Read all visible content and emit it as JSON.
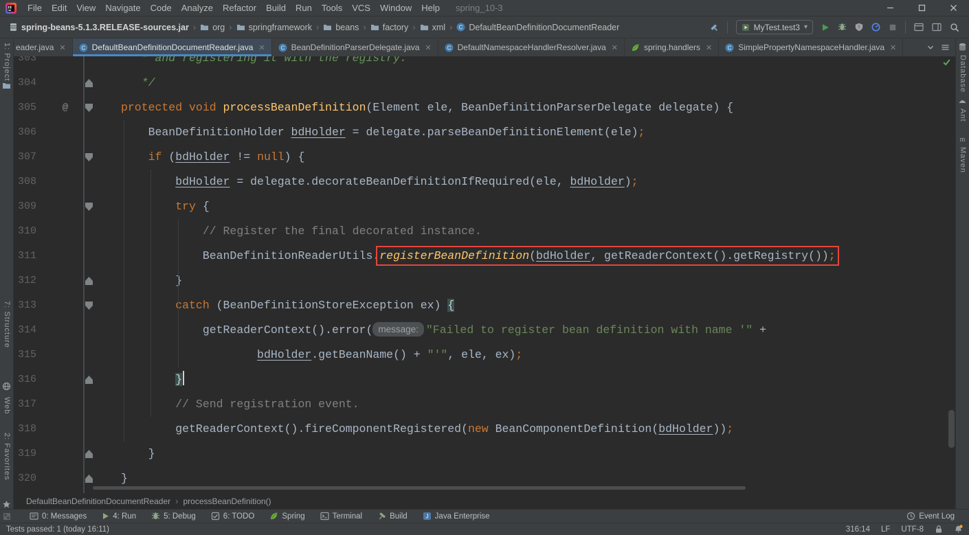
{
  "ui": {
    "chevron": "›",
    "close": "✕",
    "at": "@",
    "dropdown": "▾"
  },
  "colors": {
    "chrome_bg": "#3c3f41",
    "editor_bg": "#2b2b2b",
    "accent_blue": "#4A88C7",
    "error_red": "#e8443c",
    "run_green": "#499C54",
    "keyword_orange": "#cc7832",
    "method_yellow": "#ffc66b",
    "string_green": "#6a8759",
    "comment_gray": "#808080",
    "doc_green": "#629755",
    "brace_match_bg": "#3b514d"
  },
  "menu": {
    "items": [
      "File",
      "Edit",
      "View",
      "Navigate",
      "Code",
      "Analyze",
      "Refactor",
      "Build",
      "Run",
      "Tools",
      "VCS",
      "Window",
      "Help"
    ],
    "project": "spring_10-3"
  },
  "navbar": {
    "path": [
      {
        "label": "spring-beans-5.1.3.RELEASE-sources.jar",
        "icon": "jar",
        "bold": true
      },
      {
        "label": "org",
        "icon": "folder"
      },
      {
        "label": "springframework",
        "icon": "folder"
      },
      {
        "label": "beans",
        "icon": "folder"
      },
      {
        "label": "factory",
        "icon": "folder"
      },
      {
        "label": "xml",
        "icon": "folder"
      },
      {
        "label": "DefaultBeanDefinitionDocumentReader",
        "icon": "class"
      }
    ],
    "run_config": "MyTest.test3"
  },
  "tabs": [
    {
      "label": "eader.java",
      "icon": null,
      "partial": true
    },
    {
      "label": "DefaultBeanDefinitionDocumentReader.java",
      "icon": "class",
      "active": true
    },
    {
      "label": "BeanDefinitionParserDelegate.java",
      "icon": "class"
    },
    {
      "label": "DefaultNamespaceHandlerResolver.java",
      "icon": "class"
    },
    {
      "label": "spring.handlers",
      "icon": "spring-leaf"
    },
    {
      "label": "SimplePropertyNamespaceHandler.java",
      "icon": "class"
    }
  ],
  "editor": {
    "lines": [
      {
        "num": 303,
        "groups": [
          {
            "tokens": [
              [
                "   * and registering it with the registry.",
                "doc"
              ]
            ]
          }
        ]
      },
      {
        "num": 304,
        "fold": "up",
        "groups": [
          {
            "tokens": [
              [
                "   */",
                "doc"
              ]
            ]
          }
        ]
      },
      {
        "num": 305,
        "fold": "down",
        "at": true,
        "groups": [
          {
            "tokens": [
              [
                "protected void ",
                "kw"
              ],
              [
                "processBeanDefinition",
                "fn"
              ],
              [
                "(Element ele, BeanDefinitionParserDelegate delegate) {",
                "pl"
              ]
            ]
          }
        ]
      },
      {
        "num": 306,
        "groups": [
          {
            "tokens": [
              [
                "    BeanDefinitionHolder ",
                "pl"
              ],
              [
                "bdHolder",
                "var"
              ],
              [
                " = delegate.parseBeanDefinitionElement(ele)",
                "pl"
              ],
              [
                ";",
                "kw"
              ]
            ]
          }
        ]
      },
      {
        "num": 307,
        "fold": "down",
        "groups": [
          {
            "tokens": [
              [
                "    ",
                "pl"
              ],
              [
                "if ",
                "kw"
              ],
              [
                "(",
                "pl"
              ],
              [
                "bdHolder",
                "var"
              ],
              [
                " != ",
                "pl"
              ],
              [
                "null",
                "kw"
              ],
              [
                ") {",
                "pl"
              ]
            ]
          }
        ]
      },
      {
        "num": 308,
        "groups": [
          {
            "tokens": [
              [
                "        ",
                "pl"
              ],
              [
                "bdHolder",
                "var"
              ],
              [
                " = delegate.decorateBeanDefinitionIfRequired(ele, ",
                "pl"
              ],
              [
                "bdHolder",
                "var"
              ],
              [
                ")",
                "pl"
              ],
              [
                ";",
                "kw"
              ]
            ]
          }
        ]
      },
      {
        "num": 309,
        "fold": "down",
        "groups": [
          {
            "tokens": [
              [
                "        ",
                "pl"
              ],
              [
                "try ",
                "kw"
              ],
              [
                "{",
                "pl"
              ]
            ]
          }
        ]
      },
      {
        "num": 310,
        "groups": [
          {
            "tokens": [
              [
                "            ",
                "pl"
              ],
              [
                "// Register the final decorated instance.",
                "cm"
              ]
            ]
          }
        ]
      },
      {
        "num": 311,
        "groups": [
          {
            "tokens": [
              [
                "            BeanDefinitionReaderUtils.",
                "pl"
              ]
            ]
          },
          {
            "box": true,
            "tokens": [
              [
                "registerBeanDefinition",
                "sfn"
              ],
              [
                "(",
                "pl"
              ],
              [
                "bdHolder",
                "var"
              ],
              [
                ", getReaderContext().getRegistry())",
                "pl"
              ],
              [
                ";",
                "kw"
              ]
            ]
          }
        ]
      },
      {
        "num": 312,
        "fold": "up",
        "groups": [
          {
            "tokens": [
              [
                "        }",
                "pl"
              ]
            ]
          }
        ]
      },
      {
        "num": 313,
        "fold": "down",
        "groups": [
          {
            "tokens": [
              [
                "        ",
                "pl"
              ],
              [
                "catch ",
                "kw"
              ],
              [
                "(BeanDefinitionStoreException ex) ",
                "pl"
              ],
              [
                "{",
                "bhl"
              ]
            ]
          }
        ]
      },
      {
        "num": 314,
        "groups": [
          {
            "tokens": [
              [
                "            getReaderContext().error(",
                "pl"
              ],
              [
                "message:",
                "hint"
              ],
              [
                "\"Failed to register bean definition with name '\"",
                "str"
              ],
              [
                " +",
                "pl"
              ]
            ]
          }
        ]
      },
      {
        "num": 315,
        "groups": [
          {
            "tokens": [
              [
                "                    ",
                "pl"
              ],
              [
                "bdHolder",
                "var"
              ],
              [
                ".getBeanName() + ",
                "pl"
              ],
              [
                "\"'\"",
                "str"
              ],
              [
                ", ele, ex)",
                "pl"
              ],
              [
                ";",
                "kw"
              ]
            ]
          }
        ]
      },
      {
        "num": 316,
        "fold": "up",
        "groups": [
          {
            "tokens": [
              [
                "        ",
                "pl"
              ],
              [
                "}",
                "bhl"
              ],
              [
                "",
                "caret"
              ]
            ]
          }
        ]
      },
      {
        "num": 317,
        "groups": [
          {
            "tokens": [
              [
                "        ",
                "pl"
              ],
              [
                "// Send registration event.",
                "cm"
              ]
            ]
          }
        ]
      },
      {
        "num": 318,
        "groups": [
          {
            "tokens": [
              [
                "        getReaderContext().fireComponentRegistered(",
                "pl"
              ],
              [
                "new ",
                "kw"
              ],
              [
                "BeanComponentDefinition(",
                "pl"
              ],
              [
                "bdHolder",
                "var"
              ],
              [
                "))",
                "pl"
              ],
              [
                ";",
                "kw"
              ]
            ]
          }
        ]
      },
      {
        "num": 319,
        "fold": "up",
        "groups": [
          {
            "tokens": [
              [
                "    }",
                "pl"
              ]
            ]
          }
        ]
      },
      {
        "num": 320,
        "fold": "up",
        "groups": [
          {
            "tokens": [
              [
                "}",
                "pl"
              ]
            ]
          }
        ]
      }
    ],
    "breadcrumbs": [
      "DefaultBeanDefinitionDocumentReader",
      "processBeanDefinition()"
    ]
  },
  "stripes": {
    "left": [
      {
        "id": "project",
        "label": "1: Project"
      },
      {
        "id": "structure",
        "label": "7: Structure"
      },
      {
        "id": "web",
        "label": "Web"
      },
      {
        "id": "favorites",
        "label": "2: Favorites"
      }
    ],
    "right": [
      {
        "id": "database",
        "label": "Database"
      },
      {
        "id": "ant",
        "label": "Ant"
      },
      {
        "id": "maven",
        "label": "Maven"
      }
    ]
  },
  "toolwindow_bar": {
    "left": [
      {
        "label": "0: Messages",
        "icon": "messages"
      },
      {
        "label": "4: Run",
        "icon": "run-small"
      },
      {
        "label": "5: Debug",
        "icon": "bug"
      },
      {
        "label": "6: TODO",
        "icon": "todo"
      },
      {
        "label": "Spring",
        "icon": "spring-leaf"
      },
      {
        "label": "Terminal",
        "icon": "terminal"
      },
      {
        "label": "Build",
        "icon": "build"
      },
      {
        "label": "Java Enterprise",
        "icon": "java-ee"
      }
    ],
    "right": [
      {
        "label": "Event Log",
        "icon": "event-log"
      }
    ]
  },
  "status_bar": {
    "left": "Tests passed: 1 (today 16:11)",
    "caret": "316:14",
    "line_ending": "LF",
    "encoding": "UTF-8"
  }
}
